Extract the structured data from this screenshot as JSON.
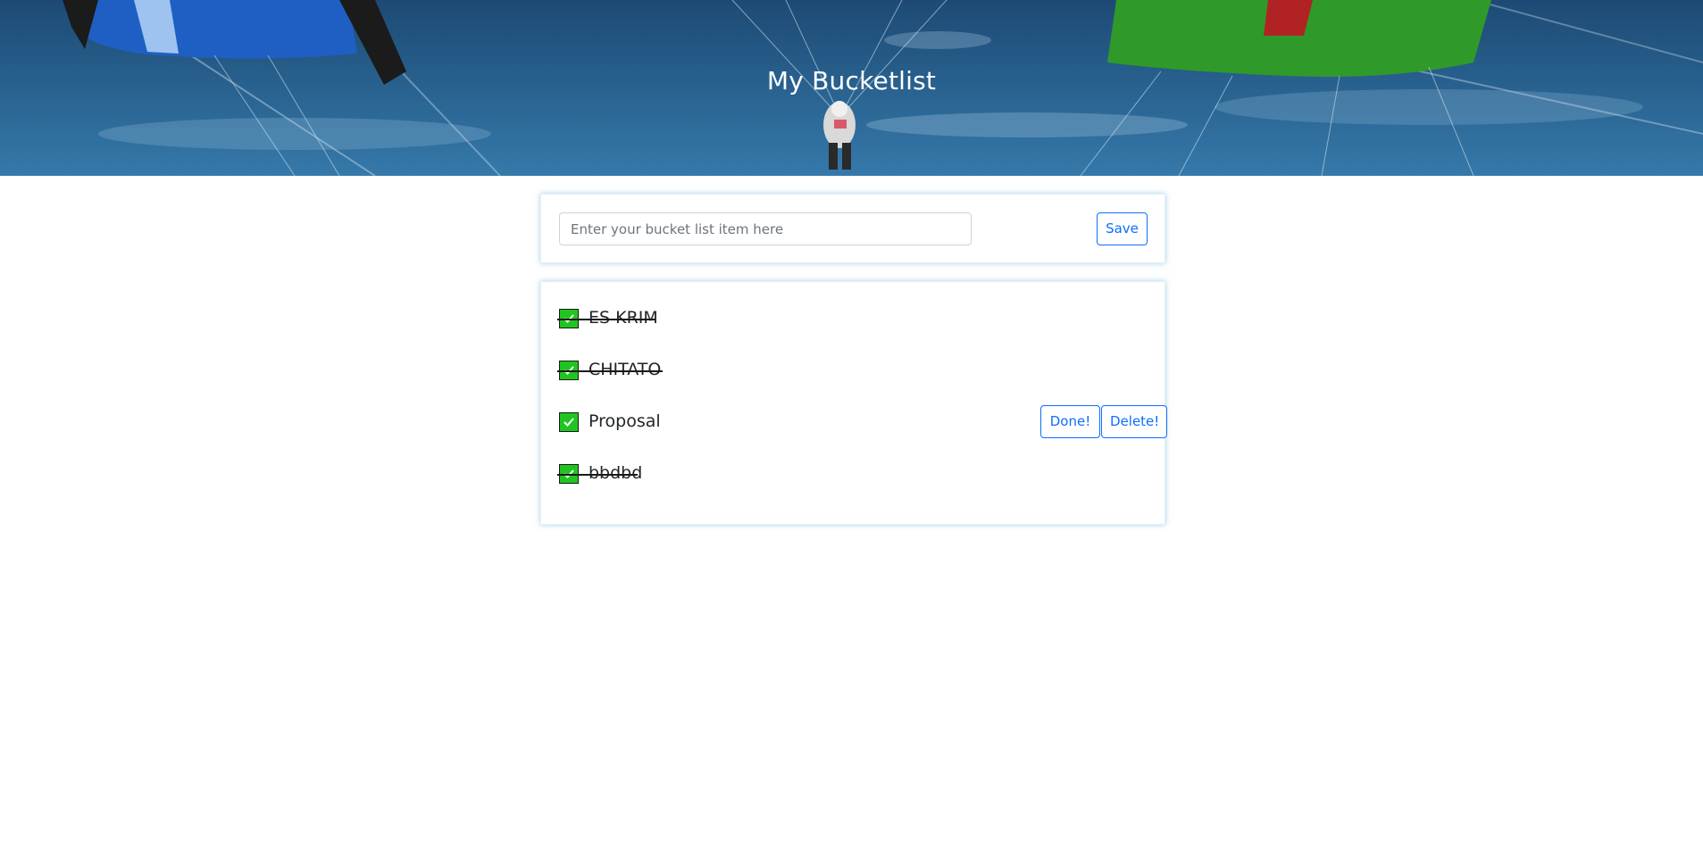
{
  "header": {
    "title": "My Bucketlist"
  },
  "form": {
    "placeholder": "Enter your bucket list item here",
    "value": "",
    "save_label": "Save"
  },
  "items": [
    {
      "label": "ES KRIM",
      "done": true
    },
    {
      "label": "CHITATO",
      "done": true
    },
    {
      "label": "Proposal",
      "done": false,
      "done_label": "Done!",
      "delete_label": "Delete!"
    },
    {
      "label": "bbdbd",
      "done": true
    }
  ],
  "colors": {
    "accent": "#0d6efd",
    "check": "#21c521"
  }
}
